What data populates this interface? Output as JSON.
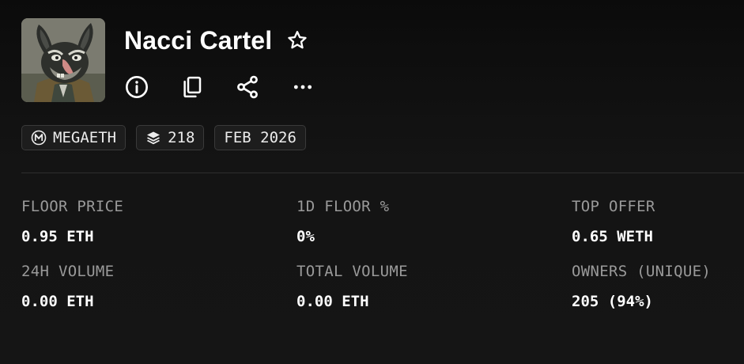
{
  "collection": {
    "name": "Nacci Cartel"
  },
  "tags": {
    "chain": "MEGAETH",
    "item_count": "218",
    "date": "FEB 2026"
  },
  "stats": [
    {
      "label": "FLOOR PRICE",
      "value": "0.95 ETH"
    },
    {
      "label": "1D FLOOR %",
      "value": "0%"
    },
    {
      "label": "TOP OFFER",
      "value": "0.65 WETH"
    },
    {
      "label": "24H VOLUME",
      "value": "0.00 ETH"
    },
    {
      "label": "TOTAL VOLUME",
      "value": "0.00 ETH"
    },
    {
      "label": "OWNERS (UNIQUE)",
      "value": "205 (94%)"
    }
  ],
  "icons": {
    "favorite": "star-icon",
    "info": "info-icon",
    "copy": "copy-icon",
    "share": "share-icon",
    "more": "more-icon",
    "chain": "megaeth-logo-icon",
    "items": "layers-icon"
  },
  "colors": {
    "background": "#111111",
    "label": "#9a9a9a",
    "value": "#ffffff",
    "chip_border": "#3a3a3a"
  }
}
